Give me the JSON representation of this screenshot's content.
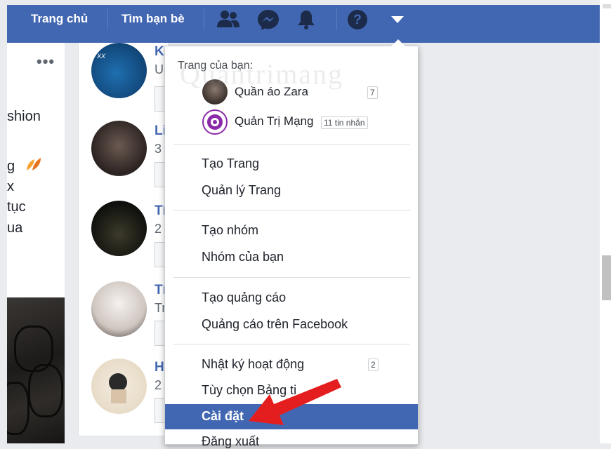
{
  "topbar": {
    "home": "Trang chủ",
    "find_friends": "Tìm bạn bè"
  },
  "icons": {
    "friends": "friends-icon",
    "messenger": "messenger-icon",
    "notifications": "bell-icon",
    "help": "help-icon",
    "menu": "caret-down-icon"
  },
  "left": {
    "more": "•••",
    "fragments": [
      "shion",
      "g",
      "x",
      "tục",
      "ua"
    ]
  },
  "middle": {
    "items": [
      {
        "name": "K",
        "sub": "U"
      },
      {
        "name": "Li",
        "sub": "3"
      },
      {
        "name": "Tí",
        "sub": "2"
      },
      {
        "name": "Tí",
        "sub": "Tr"
      },
      {
        "name": "H",
        "sub": "2"
      }
    ]
  },
  "dropdown": {
    "heading": "Trang của bạn:",
    "pages": [
      {
        "name": "Quần áo Zara",
        "badge": "7"
      },
      {
        "name": "Quản Trị Mạng",
        "badge": "11 tin nhắn"
      }
    ],
    "create_page": "Tạo Trang",
    "manage_pages": "Quản lý Trang",
    "create_group": "Tạo nhóm",
    "your_groups": "Nhóm của bạn",
    "create_ad": "Tạo quảng cáo",
    "fb_ads": "Quảng cáo trên Facebook",
    "activity_log": "Nhật ký hoạt động",
    "activity_badge": "2",
    "news_feed_prefs": "Tùy chọn Bảng ti",
    "settings": "Cài đặt",
    "logout": "Đăng xuất"
  },
  "watermark": "Quantrimang",
  "colors": {
    "brand": "#4267b2",
    "highlight": "#4267b2",
    "arrow": "#e41e1e"
  }
}
